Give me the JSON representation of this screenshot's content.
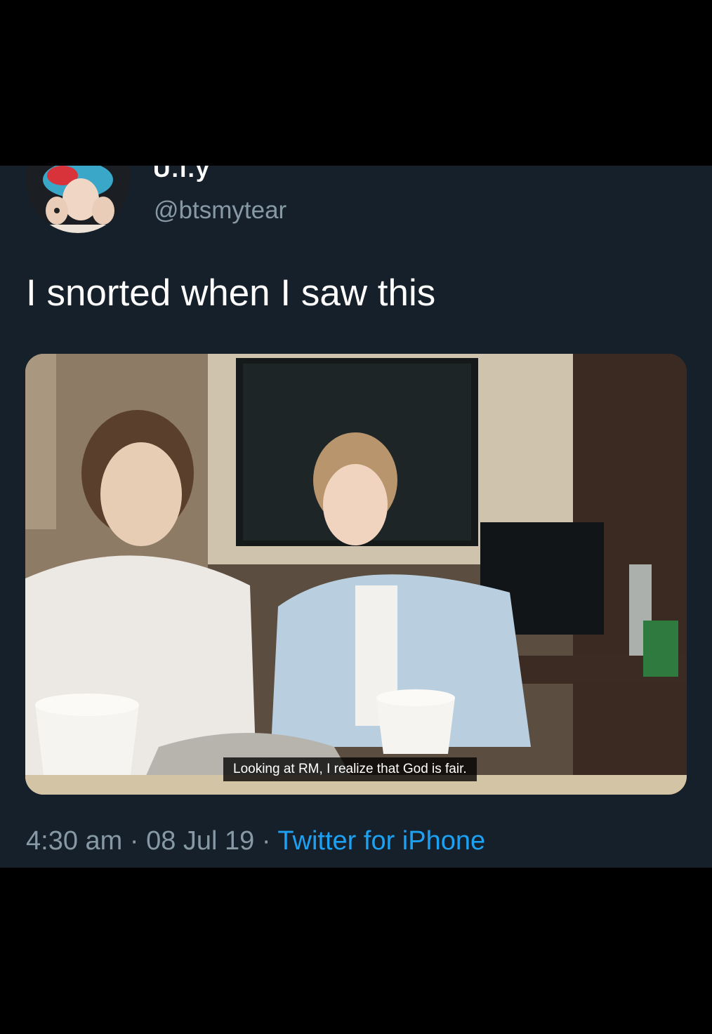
{
  "tweet": {
    "display_name": "U.ı.y",
    "handle": "@btsmytear",
    "text": "I snorted when I saw this",
    "media": {
      "subtitle": "Looking at RM, I realize that God is fair."
    },
    "time": "4:30 am",
    "separator": "·",
    "date": "08 Jul 19",
    "source": "Twitter for iPhone"
  },
  "colors": {
    "background": "#15202b",
    "frame": "#000000",
    "text_primary": "#ffffff",
    "text_secondary": "#8899a6",
    "link": "#1da1f2"
  },
  "icons": {
    "avatar": "profile-photo"
  }
}
